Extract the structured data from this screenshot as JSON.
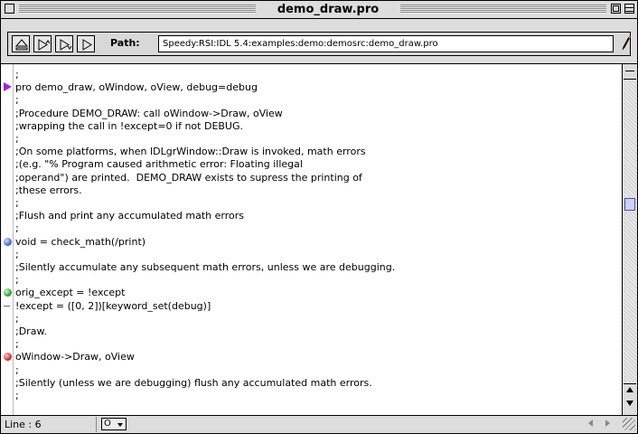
{
  "window": {
    "title": "demo_draw.pro"
  },
  "toolbar": {
    "path_label": "Path:",
    "path_value": "Speedy:RSI:IDL 5.4:examples:demo:demosrc:demo_draw.pro",
    "buttons": [
      "eject-icon",
      "step-into-icon",
      "step-over-icon",
      "run-icon"
    ]
  },
  "editor": {
    "lines": [
      {
        "text": ";",
        "marker": ""
      },
      {
        "text": "pro demo_draw, oWindow, oView, debug=debug",
        "marker": "arrow"
      },
      {
        "text": ";",
        "marker": ""
      },
      {
        "text": ";Procedure DEMO_DRAW: call oWindow->Draw, oView",
        "marker": ""
      },
      {
        "text": ";wrapping the call in !except=0 if not DEBUG.",
        "marker": ""
      },
      {
        "text": ";",
        "marker": ""
      },
      {
        "text": ";On some platforms, when IDLgrWindow::Draw is invoked, math errors",
        "marker": ""
      },
      {
        "text": ";(e.g. \"% Program caused arithmetic error: Floating illegal",
        "marker": ""
      },
      {
        "text": ";operand\") are printed.  DEMO_DRAW exists to supress the printing of",
        "marker": ""
      },
      {
        "text": ";these errors.",
        "marker": ""
      },
      {
        "text": ";",
        "marker": ""
      },
      {
        "text": ";Flush and print any accumulated math errors",
        "marker": ""
      },
      {
        "text": ";",
        "marker": ""
      },
      {
        "text": "void = check_math(/print)",
        "marker": "blue"
      },
      {
        "text": ";",
        "marker": ""
      },
      {
        "text": ";Silently accumulate any subsequent math errors, unless we are debugging.",
        "marker": ""
      },
      {
        "text": ";",
        "marker": ""
      },
      {
        "text": "orig_except = !except",
        "marker": "green"
      },
      {
        "text": "!except = ([0, 2])[keyword_set(debug)]",
        "marker": "dash"
      },
      {
        "text": ";",
        "marker": ""
      },
      {
        "text": ";Draw.",
        "marker": ""
      },
      {
        "text": ";",
        "marker": ""
      },
      {
        "text": "oWindow->Draw, oView",
        "marker": "red"
      },
      {
        "text": ";",
        "marker": ""
      },
      {
        "text": ";Silently (unless we are debugging) flush any accumulated math errors.",
        "marker": ""
      },
      {
        "text": ";",
        "marker": ""
      }
    ]
  },
  "status": {
    "line_label": "Line : 6",
    "popup_value": "O"
  },
  "colors": {
    "breakpoint_arrow": "#a020f0",
    "marker_blue": "#2a5fd0",
    "marker_green": "#1a9a1a",
    "marker_red": "#cc1a1a"
  }
}
